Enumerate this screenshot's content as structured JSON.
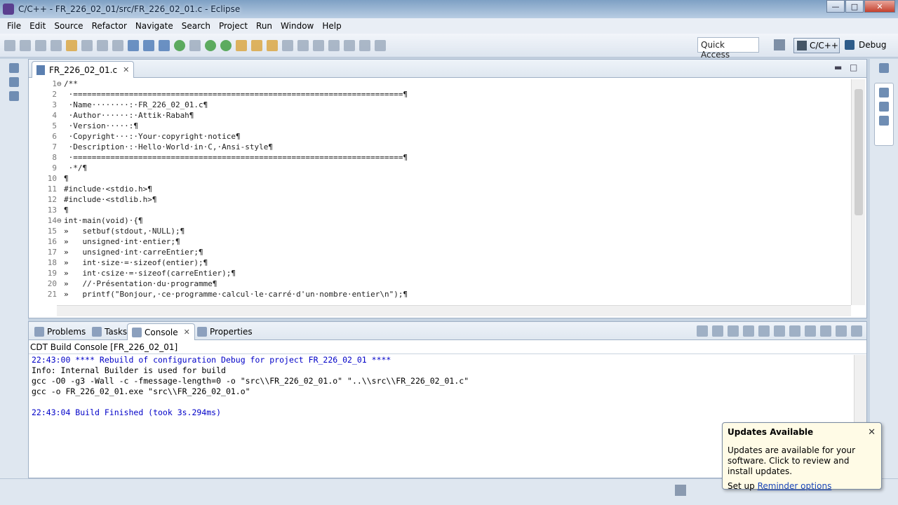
{
  "window": {
    "title": "C/C++ - FR_226_02_01/src/FR_226_02_01.c - Eclipse"
  },
  "menu": [
    "File",
    "Edit",
    "Source",
    "Refactor",
    "Navigate",
    "Search",
    "Project",
    "Run",
    "Window",
    "Help"
  ],
  "toolbar": {
    "quick_access": "Quick Access",
    "perspective_cpp": "C/C++",
    "perspective_debug": "Debug"
  },
  "editor": {
    "tab_label": "FR_226_02_01.c",
    "lines": [
      {
        "n": "1",
        "fold": "⊖",
        "text": "/**"
      },
      {
        "n": "2",
        "fold": "",
        "text": " ·=======================================================================¶"
      },
      {
        "n": "3",
        "fold": "",
        "text": " ·Name········:·FR_226_02_01.c¶"
      },
      {
        "n": "4",
        "fold": "",
        "text": " ·Author······:·Attik·Rabah¶"
      },
      {
        "n": "5",
        "fold": "",
        "text": " ·Version·····:¶"
      },
      {
        "n": "6",
        "fold": "",
        "text": " ·Copyright···:·Your·copyright·notice¶"
      },
      {
        "n": "7",
        "fold": "",
        "text": " ·Description·:·Hello·World·in·C,·Ansi-style¶"
      },
      {
        "n": "8",
        "fold": "",
        "text": " ·=======================================================================¶"
      },
      {
        "n": "9",
        "fold": "",
        "text": " ·*/¶"
      },
      {
        "n": "10",
        "fold": "",
        "text": "¶"
      },
      {
        "n": "11",
        "fold": "",
        "text": "#include·<stdio.h>¶"
      },
      {
        "n": "12",
        "fold": "",
        "text": "#include·<stdlib.h>¶"
      },
      {
        "n": "13",
        "fold": "",
        "text": "¶"
      },
      {
        "n": "14",
        "fold": "⊖",
        "text": "int·main(void)·{¶"
      },
      {
        "n": "15",
        "fold": "",
        "text": "»   setbuf(stdout,·NULL);¶"
      },
      {
        "n": "16",
        "fold": "",
        "text": "»   unsigned·int·entier;¶"
      },
      {
        "n": "17",
        "fold": "",
        "text": "»   unsigned·int·carreEntier;¶"
      },
      {
        "n": "18",
        "fold": "",
        "text": "»   int·size·=·sizeof(entier);¶"
      },
      {
        "n": "19",
        "fold": "",
        "text": "»   int·csize·=·sizeof(carreEntier);¶"
      },
      {
        "n": "20",
        "fold": "",
        "text": "»   //·Présentation·du·programme¶"
      },
      {
        "n": "21",
        "fold": "",
        "text": "»   printf(\"Bonjour,·ce·programme·calcul·le·carré·d'un·nombre·entier\\n\");¶"
      }
    ]
  },
  "console": {
    "tabs": [
      "Problems",
      "Tasks",
      "Console",
      "Properties"
    ],
    "label": "CDT Build Console [FR_226_02_01]",
    "lines": [
      "22:43:00 **** Rebuild of configuration Debug for project FR_226_02_01 ****",
      "Info: Internal Builder is used for build",
      "gcc -O0 -g3 -Wall -c -fmessage-length=0 -o \"src\\\\FR_226_02_01.o\" \"..\\\\src\\\\FR_226_02_01.c\"",
      "gcc -o FR_226_02_01.exe \"src\\\\FR_226_02_01.o\"",
      "",
      "22:43:04 Build Finished (took 3s.294ms)"
    ]
  },
  "popup": {
    "title": "Updates Available",
    "body": "Updates are available for your software. Click to review and install updates.",
    "footer_prefix": "Set up",
    "link": "Reminder options"
  }
}
